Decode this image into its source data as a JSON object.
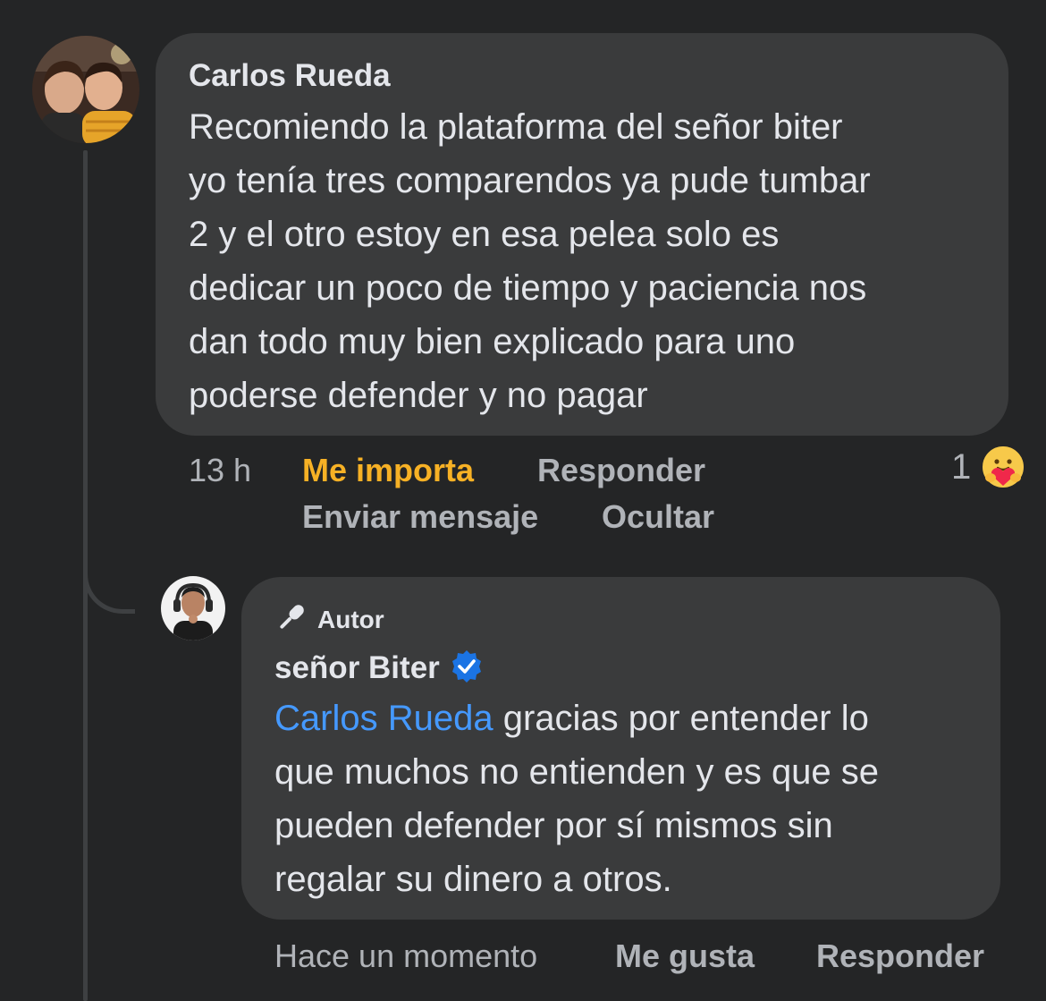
{
  "comment": {
    "author": "Carlos Rueda",
    "text": "Recomiendo la plataforma del señor biter\nyo tenía tres comparendos ya pude tumbar\n2 y el otro estoy en esa pelea solo es\ndedicar un poco de tiempo y paciencia nos\ndan todo muy bien explicado para uno\npoderse defender y no pagar",
    "time": "13 h",
    "actions": {
      "like": "Me importa",
      "reply": "Responder",
      "message": "Enviar mensaje",
      "hide": "Ocultar"
    },
    "reaction_count": "1",
    "reaction_icon": "care-heart-emoji"
  },
  "reply": {
    "badge": "Autor",
    "author": "señor Biter",
    "verified": true,
    "mention": "Carlos Rueda",
    "text": " gracias por entender lo\nque muchos no entienden y es que se\npueden defender por sí mismos sin\nregalar su dinero a otros.",
    "time": "Hace un momento",
    "actions": {
      "like": "Me gusta",
      "reply": "Responder"
    }
  },
  "colors": {
    "background": "#242526",
    "bubble": "#3a3b3c",
    "mention": "#4599ff",
    "liked": "#f7b125",
    "verified": "#1b74e4",
    "secondary_text": "#b0b3b8"
  }
}
